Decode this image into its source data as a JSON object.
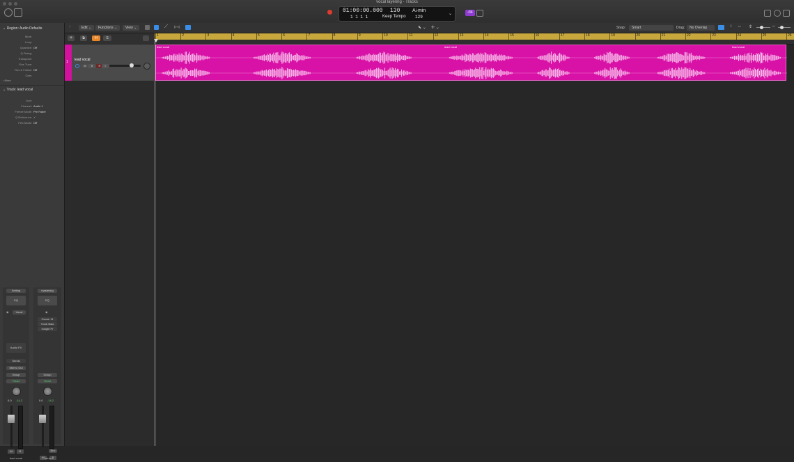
{
  "window": {
    "title": "vocal layering - Tracks"
  },
  "transport": {
    "timecode": "01:00:00.000",
    "bars": "1  1  1     1",
    "tempo": "130",
    "tempo_sub": "129",
    "key": "A♭min",
    "tempo_mode": "Keep Tempo",
    "badge": "‹34"
  },
  "inspector": {
    "region_header": "Region: Audio Defaults",
    "region_rows": [
      {
        "label": "Mute:",
        "value": ""
      },
      {
        "label": "Loop:",
        "value": ""
      },
      {
        "label": "Quantize:",
        "value": "Off"
      },
      {
        "label": "Q-Swing:",
        "value": ""
      },
      {
        "label": "Transpose:",
        "value": ""
      },
      {
        "label": "Fine Tune:",
        "value": ""
      },
      {
        "label": "Flex & Follow:",
        "value": "Off"
      },
      {
        "label": "Gain:",
        "value": ""
      }
    ],
    "more_label": "More",
    "track_header": "Track: lead vocal",
    "track_rows": [
      {
        "label": "Icon:",
        "value": ""
      },
      {
        "label": "Channel:",
        "value": "Audio 1"
      },
      {
        "label": "Freeze Mode:",
        "value": "Pre Fader"
      },
      {
        "label": "Q-Reference:",
        "value": "✓"
      },
      {
        "label": "Flex Mode:",
        "value": "Off"
      }
    ]
  },
  "channel_strips": [
    {
      "setting": "Setting",
      "eq": "EQ",
      "input": "Vocal",
      "plugins": [
        "Audio FX"
      ],
      "sends": "Sends",
      "output": "Stereo Out",
      "group": "Group",
      "automation": "Read",
      "pan": "0.0",
      "level": "-14.2",
      "name": "lead vocal",
      "mute": "M",
      "solo": "S"
    },
    {
      "setting": "mastering",
      "eq": "EQ",
      "input": "",
      "plugins": [
        "Ozone 11",
        "Tonal Bala",
        "Insight Pr"
      ],
      "sends": "",
      "output": "",
      "group": "Group",
      "automation": "Read",
      "pan": "0.0",
      "level": "-14.2",
      "name": "stereo",
      "mute": "M",
      "solo": "S",
      "extra": "Bnc"
    }
  ],
  "toolbar": {
    "edit": "Edit",
    "functions": "Functions",
    "view": "View",
    "snap_label": "Snap:",
    "snap_value": "Smart",
    "drag_label": "Drag:",
    "drag_value": "No Overlap",
    "h_btn": "H",
    "s_btn": "S"
  },
  "track": {
    "number": "1",
    "name": "lead vocal",
    "mute": "M",
    "solo": "S",
    "record": "R",
    "input": "I"
  },
  "ruler": {
    "bars": [
      "1",
      "2",
      "3",
      "4",
      "5",
      "6",
      "7",
      "8",
      "9",
      "10",
      "11",
      "12",
      "13",
      "14",
      "15",
      "16",
      "17",
      "18",
      "19",
      "20",
      "21",
      "22",
      "23",
      "24",
      "25",
      "26"
    ]
  },
  "region": {
    "name": "lead vocal",
    "color": "#d812a6"
  },
  "regions_labels": [
    "lead vocal",
    "lead vocal",
    "lead vocal"
  ],
  "waveform_segments": [
    [
      0.01,
      0.085
    ],
    [
      0.155,
      0.245
    ],
    [
      0.318,
      0.405
    ],
    [
      0.465,
      0.565
    ],
    [
      0.605,
      0.655
    ],
    [
      0.695,
      0.75
    ],
    [
      0.795,
      0.87
    ],
    [
      0.91,
      0.99
    ]
  ]
}
